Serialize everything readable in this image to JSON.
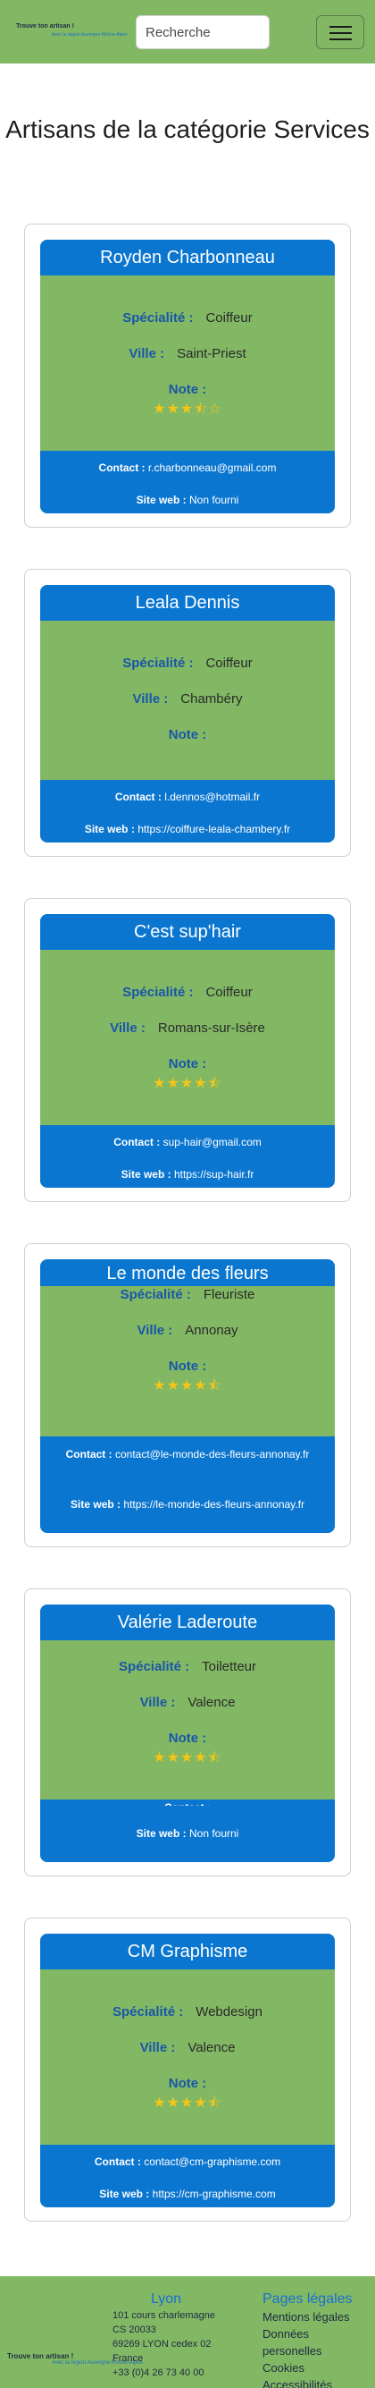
{
  "header": {
    "logo_main": "Trouve ton artisan !",
    "logo_sub": "Avec la région Auvergne-Rhône-Alpes",
    "search_placeholder": "Recherche"
  },
  "page_title": "Artisans de la catégorie Services",
  "labels": {
    "specialty": "Spécialité :",
    "city": "Ville :",
    "rating": "Note :",
    "contact": "Contact :",
    "website": "Site web :"
  },
  "artisans": [
    {
      "name": "Royden Charbonneau",
      "specialty": "Coiffeur",
      "city": "Saint-Priest",
      "rating": 3.5,
      "stars": "★★★⯪☆",
      "contact": "r.charbonneau@gmail.com",
      "website": "Non fourni"
    },
    {
      "name": "Leala Dennis",
      "specialty": "Coiffeur",
      "city": "Chambéry",
      "rating": null,
      "stars": "",
      "contact": "l.dennos@hotmail.fr",
      "website": "https://coiffure-leala-chambery.fr"
    },
    {
      "name": "C'est sup'hair",
      "specialty": "Coiffeur",
      "city": "Romans-sur-Isère",
      "rating": 4.5,
      "stars": "★★★★⯪",
      "contact": "sup-hair@gmail.com",
      "website": "https://sup-hair.fr"
    },
    {
      "name": "Le monde des fleurs",
      "specialty": "Fleuriste",
      "city": "Annonay",
      "rating": 4.5,
      "stars": "★★★★⯪",
      "contact": "contact@le-monde-des-fleurs-annonay.fr",
      "website": "https://le-monde-des-fleurs-annonay.fr"
    },
    {
      "name": "Valérie Laderoute",
      "specialty": "Toiletteur",
      "city": "Valence",
      "rating": 4.5,
      "stars": "★★★★⯪",
      "contact": "",
      "website": "Non fourni"
    },
    {
      "name": "CM Graphisme",
      "specialty": "Webdesign",
      "city": "Valence",
      "rating": 4.5,
      "stars": "★★★★⯪",
      "contact": "contact@cm-graphisme.com",
      "website": "https://cm-graphisme.com"
    }
  ],
  "footer": {
    "logo_main": "Trouve ton artisan !",
    "logo_sub": "Avec la région Auvergne-Rhône-Alpes",
    "address_title": "Lyon",
    "address_lines": [
      "101 cours charlemagne",
      "CS 20033",
      "69269 LYON cedex 02",
      "France",
      "+33 (0)4 26 73 40 00"
    ],
    "legal_title": "Pages légales",
    "legal_links": [
      "Mentions légales",
      "Données personelles",
      "Cookies",
      "Accessibilités"
    ]
  }
}
